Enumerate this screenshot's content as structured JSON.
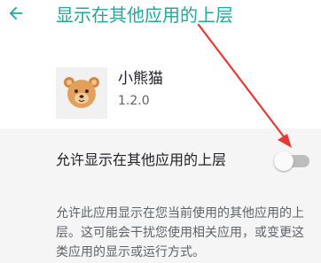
{
  "header": {
    "title": "显示在其他应用的上层"
  },
  "app": {
    "name": "小熊猫",
    "version": "1.2.0"
  },
  "permission": {
    "label": "允许显示在其他应用的上层",
    "enabled": false
  },
  "description": "允许此应用显示在您当前使用的其他应用的上层。这可能会干扰您使用相关应用，或变更这类应用的显示或运行方式。",
  "colors": {
    "accent": "#26a69a",
    "annotation_arrow": "#e53935"
  }
}
